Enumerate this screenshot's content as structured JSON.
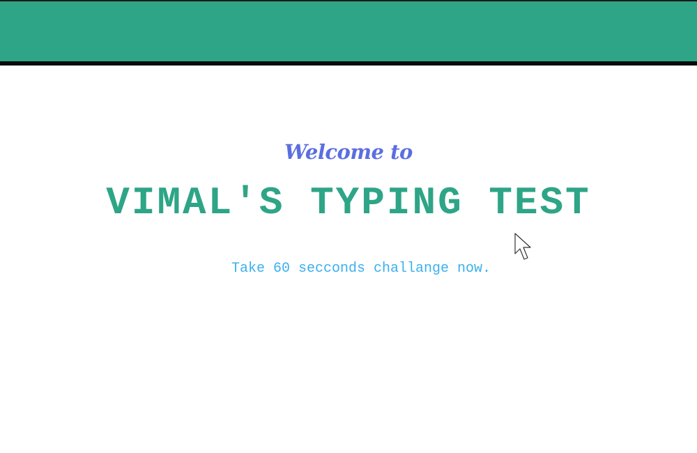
{
  "header": {
    "brand_color": "#2da586"
  },
  "hero": {
    "welcome_text": "Welcome to",
    "title": "VIMAL'S TYPING TEST",
    "subtitle": "Take 60 secconds challange now."
  },
  "colors": {
    "welcome": "#5b6ee0",
    "title": "#2da586",
    "subtitle": "#3bb0ee"
  },
  "icons": {
    "cursor": "mouse-pointer-icon"
  }
}
